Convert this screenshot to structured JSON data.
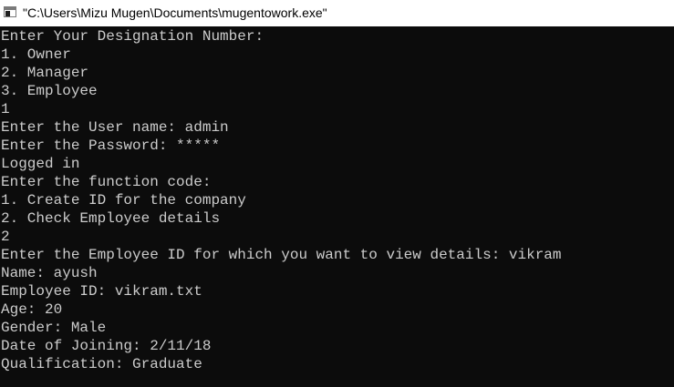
{
  "window": {
    "title": "\"C:\\Users\\Mizu Mugen\\Documents\\mugentowork.exe\"",
    "icon": "console-app-icon"
  },
  "console": {
    "lines": [
      "Enter Your Designation Number:",
      "1. Owner",
      "2. Manager",
      "3. Employee",
      "1",
      "Enter the User name: admin",
      "Enter the Password: *****",
      "Logged in",
      "Enter the function code:",
      "1. Create ID for the company",
      "2. Check Employee details",
      "2",
      "Enter the Employee ID for which you want to view details: vikram",
      "Name: ayush",
      "Employee ID: vikram.txt",
      "Age: 20",
      "Gender: Male",
      "Date of Joining: 2/11/18",
      "Qualification: Graduate"
    ],
    "colors": {
      "background": "#0c0c0c",
      "text": "#cccccc"
    }
  }
}
